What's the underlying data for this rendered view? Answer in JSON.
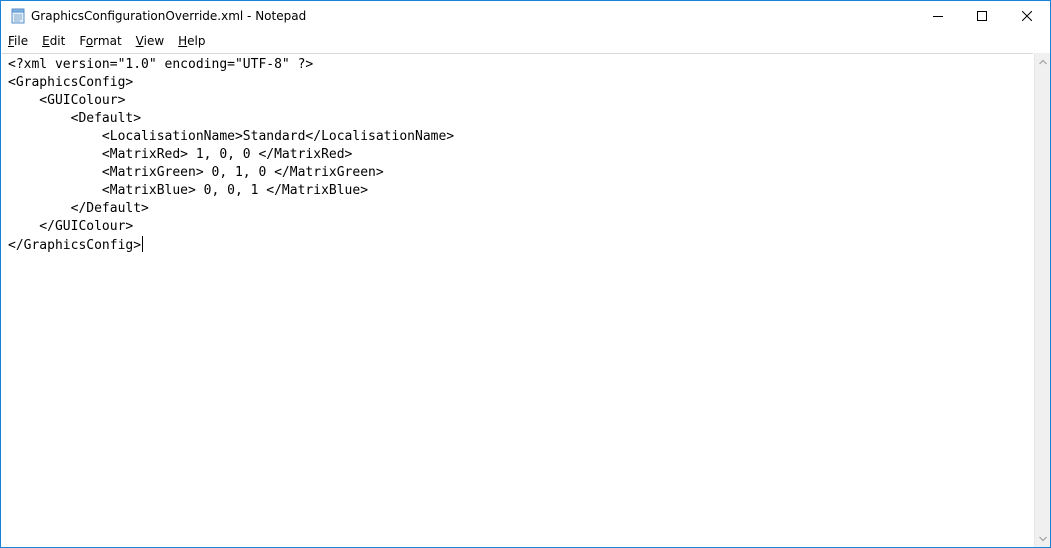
{
  "window": {
    "title": "GraphicsConfigurationOverride.xml - Notepad",
    "app_icon": "notepad-icon",
    "controls": [
      "minimize-icon",
      "maximize-icon",
      "close-icon"
    ]
  },
  "menu": {
    "items": [
      {
        "accel": "F",
        "rest": "ile"
      },
      {
        "accel": "E",
        "rest": "dit"
      },
      {
        "accel": "F",
        "rest": "ormat",
        "prefix": "",
        "accel_index": 1
      },
      {
        "accel": "V",
        "rest": "iew"
      },
      {
        "accel": "H",
        "rest": "elp"
      }
    ]
  },
  "editor": {
    "lines": [
      "<?xml version=\"1.0\" encoding=\"UTF-8\" ?>",
      "<GraphicsConfig>",
      "    <GUIColour>",
      "        <Default>",
      "            <LocalisationName>Standard</LocalisationName>",
      "            <MatrixRed> 1, 0, 0 </MatrixRed>",
      "            <MatrixGreen> 0, 1, 0 </MatrixGreen>",
      "            <MatrixBlue> 0, 0, 1 </MatrixBlue>",
      "        </Default>",
      "    </GUIColour>",
      "</GraphicsConfig>"
    ]
  },
  "colors": {
    "border": "#1883d7",
    "scrollbar": "#f0f0f0"
  }
}
